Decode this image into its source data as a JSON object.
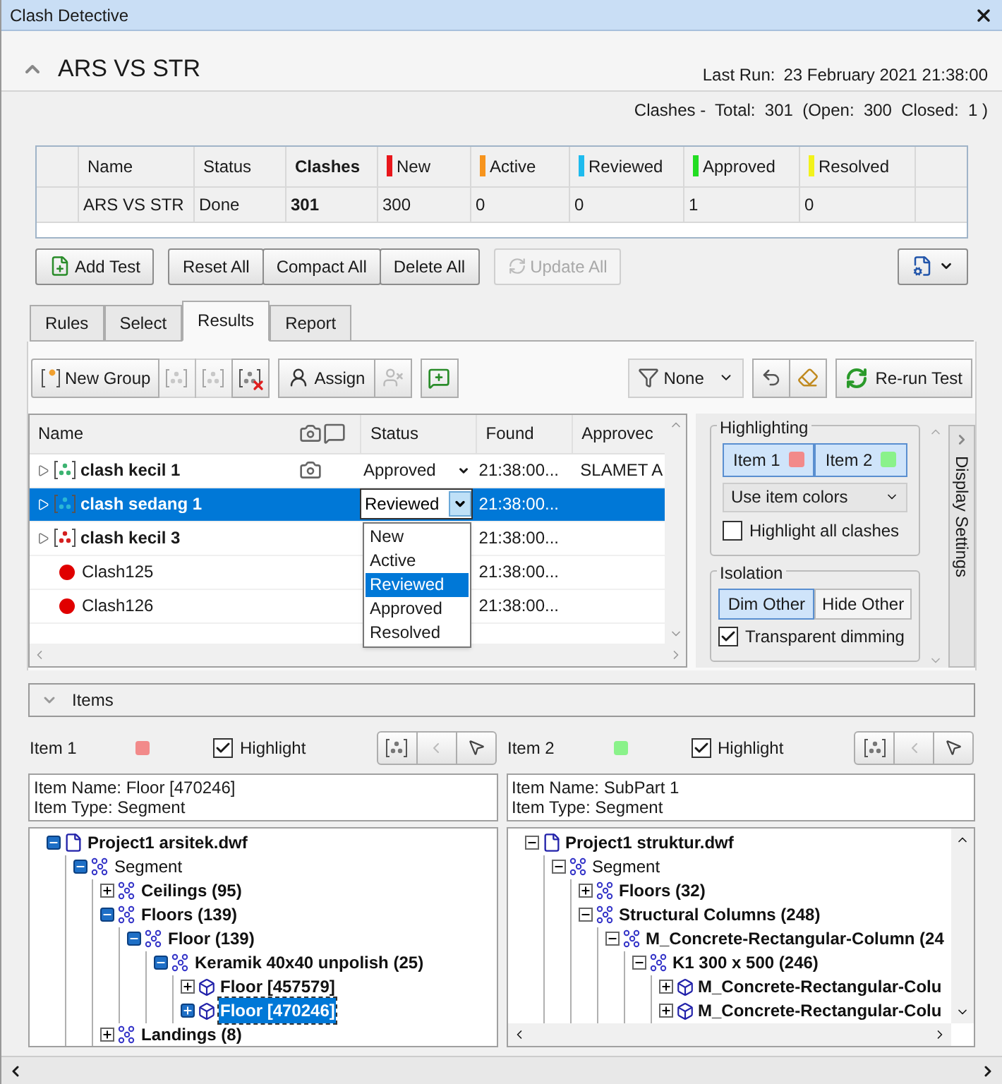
{
  "window": {
    "title": "Clash Detective"
  },
  "test": {
    "name": "ARS VS STR",
    "expanded": true,
    "last_run_label": "Last Run:",
    "last_run": "23 February 2021 21:38:00",
    "summary": "Clashes -  Total:  301  (Open:  300  Closed:  1 )"
  },
  "tests_table": {
    "columns": [
      {
        "label": "Name",
        "bold": false
      },
      {
        "label": "Status",
        "bold": false
      },
      {
        "label": "Clashes",
        "bold": true
      },
      {
        "label": "New",
        "bold": false,
        "color": "#e8161b"
      },
      {
        "label": "Active",
        "bold": false,
        "color": "#f7941d"
      },
      {
        "label": "Reviewed",
        "bold": false,
        "color": "#1ebbee"
      },
      {
        "label": "Approved",
        "bold": false,
        "color": "#22dd22"
      },
      {
        "label": "Resolved",
        "bold": false,
        "color": "#f2f21b"
      }
    ],
    "rows": [
      {
        "cells": [
          "ARS VS STR",
          "Done",
          "301",
          "300",
          "0",
          "0",
          "1",
          "0"
        ]
      }
    ]
  },
  "test_button_groups": [
    [
      {
        "label": "Add Test",
        "disabled": false
      }
    ],
    [
      {
        "label": "Reset All",
        "disabled": false
      },
      {
        "label": "Compact All",
        "disabled": false
      },
      {
        "label": "Delete All",
        "disabled": false
      }
    ],
    [
      {
        "label": "Update All",
        "disabled": true
      }
    ]
  ],
  "tabs": [
    {
      "label": "Rules",
      "selected": false
    },
    {
      "label": "Select",
      "selected": false
    },
    {
      "label": "Results",
      "selected": true
    },
    {
      "label": "Report",
      "selected": false
    }
  ],
  "results": {
    "toolbar": {
      "new_group": "New Group",
      "assign": "Assign",
      "filter": "None",
      "rerun": "Re-run Test"
    },
    "columns": [
      "Name",
      "Status",
      "Found",
      "Approvec"
    ],
    "rows": [
      {
        "kind": "group",
        "name": "clash kecil 1",
        "color": "#3cb371",
        "image": true,
        "status": "Approved",
        "found": "21:38:00...",
        "approved_by": "SLAMET A",
        "selected": false
      },
      {
        "kind": "group",
        "name": "clash sedang 1",
        "color": "#29b6d6",
        "image": false,
        "status": "Reviewed",
        "found": "21:38:00...",
        "selected": true
      },
      {
        "kind": "group",
        "name": "clash kecil 3",
        "color": "#d42020",
        "image": false,
        "found": "21:38:00...",
        "selected": false
      },
      {
        "kind": "clash",
        "name": "Clash125",
        "color": "#e00000",
        "image": false,
        "found": "21:38:00...",
        "selected": false
      },
      {
        "kind": "clash",
        "name": "Clash126",
        "color": "#e00000",
        "image": false,
        "found": "21:38:00...",
        "selected": false
      }
    ],
    "status_menu": {
      "open": true,
      "options": [
        {
          "label": "New",
          "selected": false
        },
        {
          "label": "Active",
          "selected": false
        },
        {
          "label": "Reviewed",
          "selected": true
        },
        {
          "label": "Approved",
          "selected": false
        },
        {
          "label": "Resolved",
          "selected": false
        }
      ]
    }
  },
  "display_settings": {
    "tab": "Display Settings",
    "highlighting": {
      "title": "Highlighting",
      "items": [
        {
          "label": "Item 1",
          "color": "#f28a8a",
          "selected": true
        },
        {
          "label": "Item 2",
          "color": "#8af28a",
          "selected": true
        }
      ],
      "mode": "Use item colors",
      "highlight_all": {
        "label": "Highlight all clashes",
        "checked": false
      }
    },
    "isolation": {
      "title": "Isolation",
      "options": [
        {
          "label": "Dim Other",
          "selected": true
        },
        {
          "label": "Hide Other",
          "selected": false
        }
      ],
      "transparent": {
        "label": "Transparent dimming",
        "checked": true
      }
    }
  },
  "items": {
    "title": "Items",
    "expanded": true,
    "panes": [
      {
        "label": "Item 1",
        "color": "#f28a8a",
        "highlight": {
          "label": "Highlight",
          "checked": true
        },
        "focused": true,
        "info": [
          "Item Name: Floor [470246]",
          "Item Type: Segment"
        ],
        "tree": [
          {
            "label": "Project1 arsitek.dwf",
            "kind": "file",
            "bold": true,
            "expanded": true,
            "selected": false,
            "children": [
              {
                "label": "Segment",
                "kind": "segment",
                "bold": false,
                "expanded": true,
                "selected": false,
                "children": [
                  {
                    "label": "Ceilings (95)",
                    "kind": "segment",
                    "bold": true,
                    "expanded": false,
                    "selected": false
                  },
                  {
                    "label": "Floors (139)",
                    "kind": "segment",
                    "bold": true,
                    "expanded": true,
                    "selected": false,
                    "children": [
                      {
                        "label": "Floor (139)",
                        "kind": "segment",
                        "bold": true,
                        "expanded": true,
                        "selected": false,
                        "children": [
                          {
                            "label": "Keramik 40x40 unpolish (25)",
                            "kind": "segment",
                            "bold": true,
                            "expanded": true,
                            "selected": false,
                            "children": [
                              {
                                "label": "Floor [457579]",
                                "kind": "solid",
                                "bold": true,
                                "expanded": false,
                                "selected": false
                              },
                              {
                                "label": "Floor [470246]",
                                "kind": "solid",
                                "bold": true,
                                "expanded": false,
                                "selected": true
                              }
                            ]
                          }
                        ]
                      }
                    ]
                  },
                  {
                    "label": "Landings (8)",
                    "kind": "segment",
                    "bold": true,
                    "expanded": false,
                    "selected": false
                  }
                ]
              }
            ]
          }
        ]
      },
      {
        "label": "Item 2",
        "color": "#8af28a",
        "highlight": {
          "label": "Highlight",
          "checked": true
        },
        "focused": false,
        "info": [
          "Item Name: SubPart 1",
          "Item Type: Segment"
        ],
        "tree": [
          {
            "label": "Project1 struktur.dwf",
            "kind": "file",
            "bold": true,
            "expanded": true,
            "selected": false,
            "children": [
              {
                "label": "Segment",
                "kind": "segment",
                "bold": false,
                "expanded": true,
                "selected": false,
                "children": [
                  {
                    "label": "Floors (32)",
                    "kind": "segment",
                    "bold": true,
                    "expanded": false,
                    "selected": false
                  },
                  {
                    "label": "Structural Columns (248)",
                    "kind": "segment",
                    "bold": true,
                    "expanded": true,
                    "selected": false,
                    "children": [
                      {
                        "label": "M_Concrete-Rectangular-Column (24",
                        "kind": "segment",
                        "bold": true,
                        "expanded": true,
                        "selected": false,
                        "children": [
                          {
                            "label": "K1 300 x 500 (246)",
                            "kind": "segment",
                            "bold": true,
                            "expanded": true,
                            "selected": false,
                            "children": [
                              {
                                "label": "M_Concrete-Rectangular-Colu",
                                "kind": "solid",
                                "bold": true,
                                "expanded": false,
                                "selected": false
                              },
                              {
                                "label": "M_Concrete-Rectangular-Colu",
                                "kind": "solid",
                                "bold": true,
                                "expanded": false,
                                "selected": false
                              }
                            ]
                          }
                        ]
                      }
                    ]
                  }
                ]
              }
            ]
          }
        ]
      }
    ]
  }
}
